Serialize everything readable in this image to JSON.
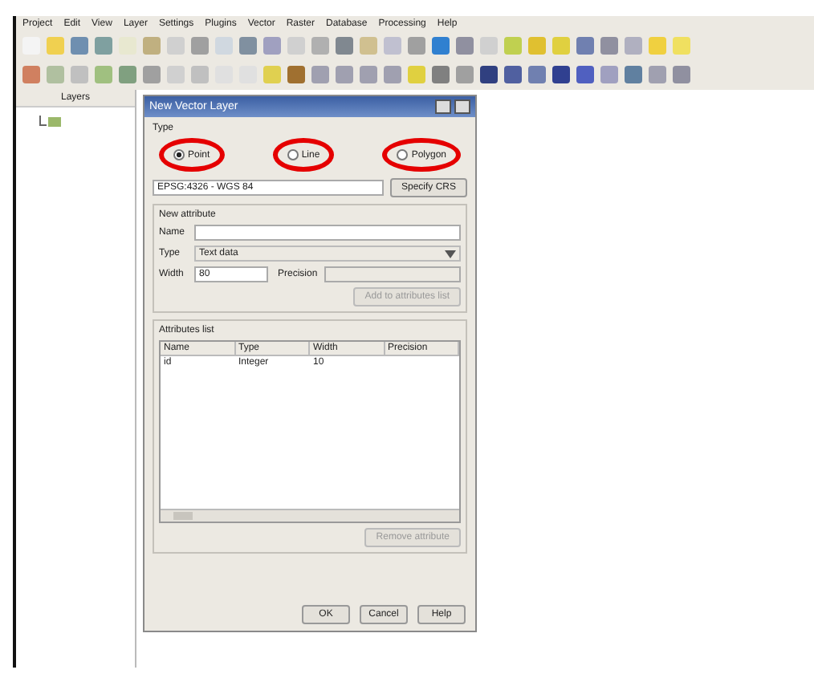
{
  "menu_bar": [
    "Project",
    "Edit",
    "View",
    "Layer",
    "Settings",
    "Plugins",
    "Vector",
    "Raster",
    "Database",
    "Processing",
    "Help"
  ],
  "layers_panel": {
    "title": "Layers"
  },
  "dialog": {
    "title": "New Vector Layer",
    "type_group": {
      "title": "Type",
      "options": [
        {
          "label": "Point",
          "selected": true,
          "circled": true
        },
        {
          "label": "Line",
          "selected": false,
          "circled": true
        },
        {
          "label": "Polygon",
          "selected": false,
          "circled": true
        }
      ]
    },
    "crs": {
      "value": "EPSG:4326 - WGS 84",
      "button": "Specify CRS"
    },
    "new_attribute": {
      "title": "New attribute",
      "name_label": "Name",
      "type_label": "Type",
      "type_value": "Text data",
      "width_label": "Width",
      "width_value": "80",
      "precision_label": "Precision",
      "add_button": {
        "label": "Add to attributes list",
        "disabled": true
      }
    },
    "attributes": {
      "title": "Attributes list",
      "columns": [
        "Name",
        "Type",
        "Width",
        "Precision"
      ],
      "rows": [
        [
          "id",
          "Integer",
          "10",
          ""
        ]
      ],
      "remove_button": {
        "label": "Remove attribute",
        "disabled": true
      }
    },
    "buttons": [
      "OK",
      "Cancel",
      "Help"
    ]
  }
}
